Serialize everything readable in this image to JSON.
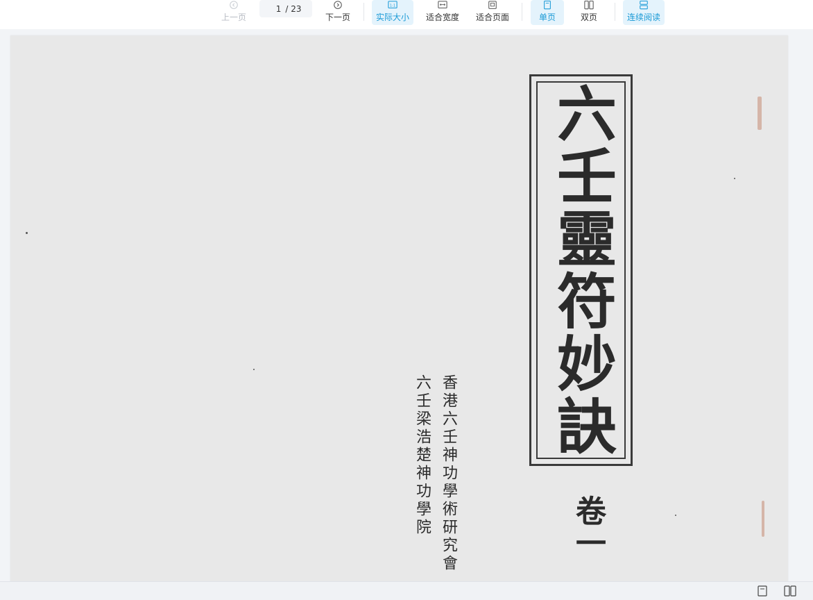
{
  "toolbar": {
    "prev_label": "上一页",
    "next_label": "下一页",
    "page_current": "1",
    "page_total": "/ 23",
    "actual_size_label": "实际大小",
    "fit_width_label": "适合宽度",
    "fit_page_label": "适合页面",
    "single_page_label": "单页",
    "double_page_label": "双页",
    "continuous_label": "连续阅读",
    "actual_size_badge": "1:1"
  },
  "document": {
    "title": "六壬靈符妙訣",
    "volume": "卷一",
    "publisher_line1": "香港六壬神功學術研究會",
    "publisher_line2": "六壬梁浩楚神功學院"
  },
  "colors": {
    "accent": "#1a9ad6",
    "active_bg": "#e4f3fc",
    "page_bg": "#e8e8e8",
    "ink": "#2b2b2b"
  }
}
